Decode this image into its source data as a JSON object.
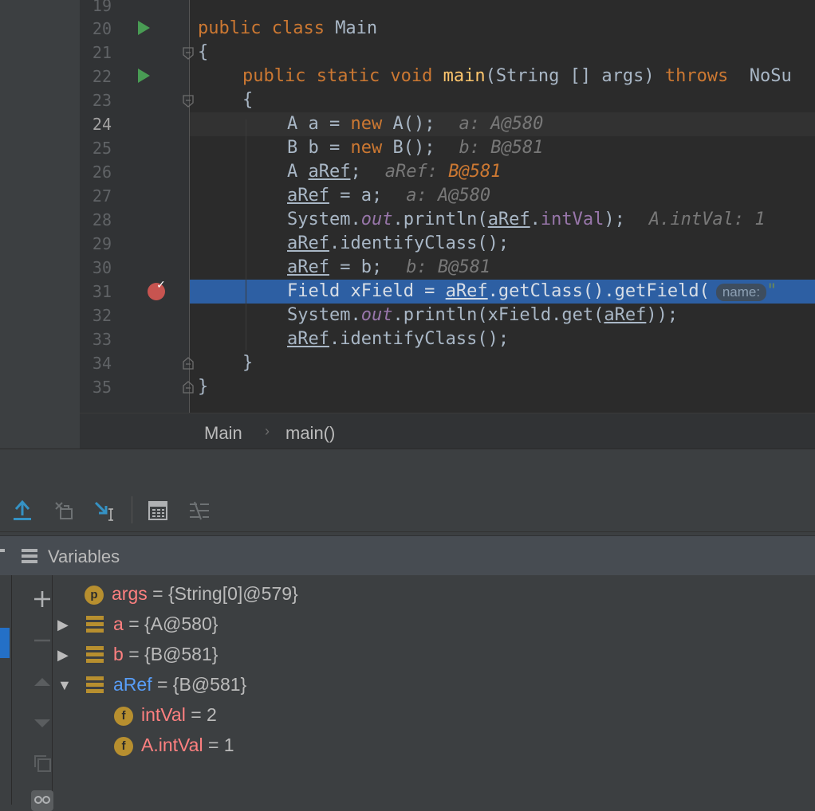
{
  "editor": {
    "line_numbers": [
      "19",
      "20",
      "21",
      "22",
      "23",
      "24",
      "25",
      "26",
      "27",
      "28",
      "29",
      "30",
      "31",
      "32",
      "33",
      "34",
      "35"
    ],
    "lines": {
      "l19": "",
      "l20_a": "public class ",
      "l20_b": "Main",
      "l21": "{",
      "l22_a": "public static void ",
      "l22_b": "main",
      "l22_c": "(String [] args) ",
      "l22_d": "throws",
      "l22_e": "  NoSu",
      "l23": "{",
      "l24_a": "A a = ",
      "l24_b": "new",
      "l24_c": " A();",
      "l24_hint": "a: A@580",
      "l25_a": "B b = ",
      "l25_b": "new",
      "l25_c": " B();",
      "l25_hint": "b: B@581",
      "l26_a": "A ",
      "l26_b": "aRef",
      "l26_c": ";",
      "l26_hint": "aRef: ",
      "l26_hint2": "B@581",
      "l27_a": "aRef",
      "l27_b": " = a;",
      "l27_hint": "a: A@580",
      "l28_a": "System.",
      "l28_b": "out",
      "l28_c": ".println(",
      "l28_d": "aRef",
      "l28_e": ".",
      "l28_f": "intVal",
      "l28_g": ");",
      "l28_hint": "A.intVal: 1",
      "l29_a": "aRef",
      "l29_b": ".identifyClass();",
      "l30_a": "aRef",
      "l30_b": " = b;",
      "l30_hint": "b: B@581",
      "l31_a": "Field xField = ",
      "l31_b": "aRef",
      "l31_c": ".getClass().getField(",
      "l31_param": "name:",
      "l31_d": "\"",
      "l32_a": "System.",
      "l32_b": "out",
      "l32_c": ".println(xField.get(",
      "l32_d": "aRef",
      "l32_e": "));",
      "l33_a": "aRef",
      "l33_b": ".identifyClass();",
      "l34": "}",
      "l35": "}"
    }
  },
  "breadcrumb": {
    "class": "Main",
    "separator": "›",
    "method": "main()"
  },
  "debugger": {
    "panel_title": "Variables",
    "variables": [
      {
        "name": "args",
        "value": "= {String[0]@579}",
        "badge": "p",
        "expanded": false
      },
      {
        "name": "a",
        "value": "= {A@580}",
        "expandable": true
      },
      {
        "name": "b",
        "value": "= {B@581}",
        "expandable": true
      },
      {
        "name": "aRef",
        "value": "= {B@581}",
        "expanded": true
      },
      {
        "name": "intVal",
        "value": "= 2",
        "badge": "f"
      },
      {
        "name": "A.intVal",
        "value": "= 1",
        "badge": "f"
      }
    ]
  },
  "colors": {
    "editor_bg": "#2b2b2b",
    "execution_line": "#2d5fa3",
    "keyword": "#cc7832",
    "breakpoint": "#c75450",
    "var_name": "#ff8080"
  }
}
